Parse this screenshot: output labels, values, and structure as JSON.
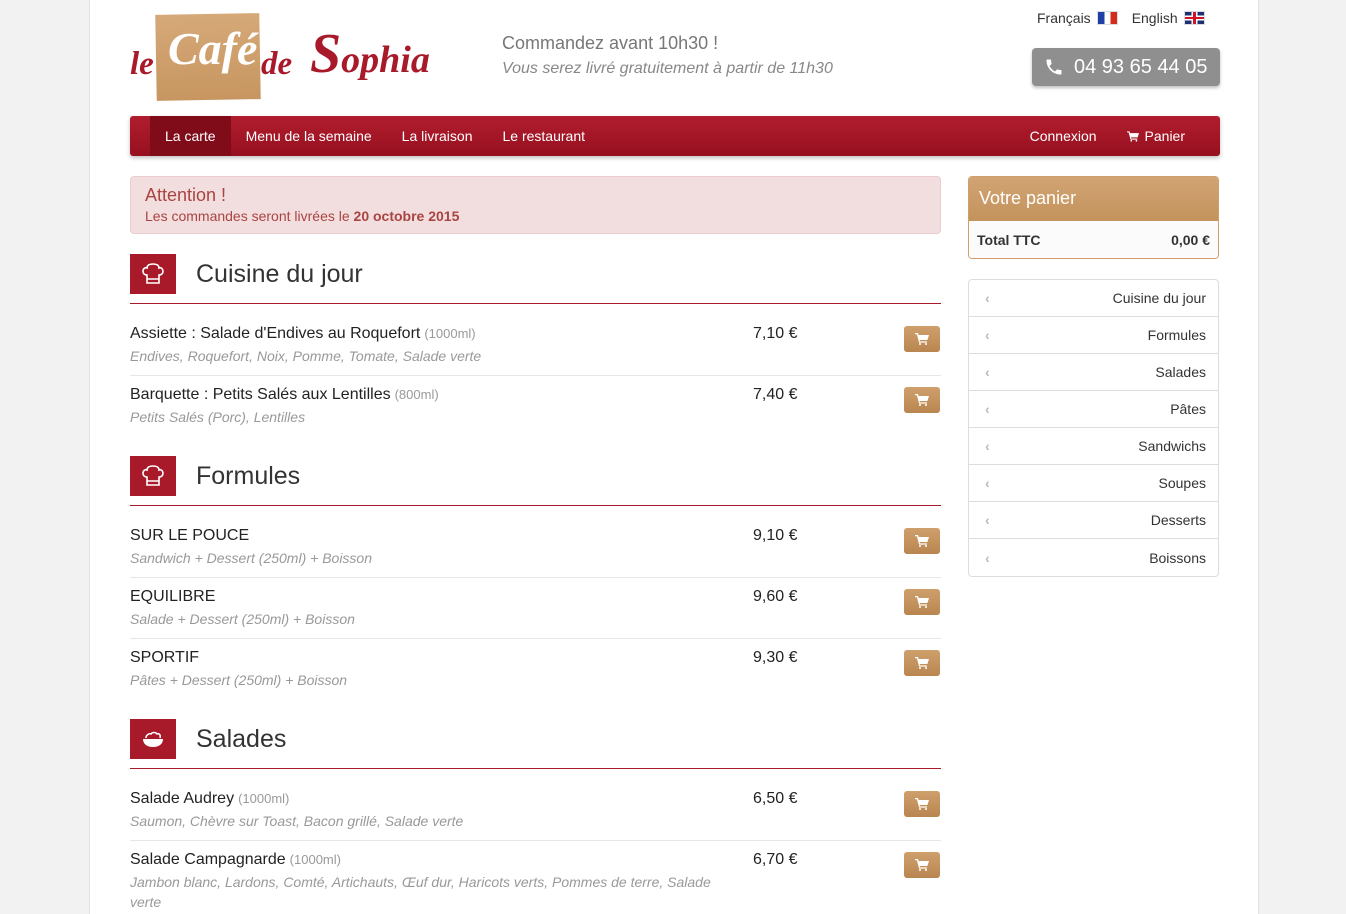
{
  "header": {
    "logo": {
      "le": "le",
      "cafe": "Café",
      "de": "de",
      "sophia_initial": "S",
      "sophia_rest": "ophia"
    },
    "tagline": "Commandez avant 10h30 !",
    "subtagline": "Vous serez livré gratuitement à partir de 11h30",
    "languages": [
      {
        "label": "Français",
        "flag": "flag-france-icon"
      },
      {
        "label": "English",
        "flag": "flag-uk-icon"
      }
    ],
    "phone": "04 93 65 44 05"
  },
  "nav": {
    "items": [
      "La carte",
      "Menu de la semaine",
      "La livraison",
      "Le restaurant"
    ],
    "active": "La carte",
    "login": "Connexion",
    "cart": "Panier"
  },
  "alert": {
    "title": "Attention !",
    "text": "Les commandes seront livrées le ",
    "date": "20 octobre 2015"
  },
  "sections": [
    {
      "title": "Cuisine du jour",
      "icon": "chef-hat-icon",
      "items": [
        {
          "name": "Assiette : Salade d'Endives au Roquefort",
          "size": "(1000ml)",
          "desc": "Endives, Roquefort, Noix, Pomme, Tomate, Salade verte",
          "price": "7,10 €"
        },
        {
          "name": "Barquette : Petits Salés aux Lentilles",
          "size": "(800ml)",
          "desc": "Petits Salés (Porc), Lentilles",
          "price": "7,40 €"
        }
      ]
    },
    {
      "title": "Formules",
      "icon": "chef-hat-icon",
      "items": [
        {
          "name": "SUR LE POUCE",
          "size": "",
          "desc": "Sandwich + Dessert (250ml) + Boisson",
          "price": "9,10 €"
        },
        {
          "name": "EQUILIBRE",
          "size": "",
          "desc": "Salade + Dessert (250ml) + Boisson",
          "price": "9,60 €"
        },
        {
          "name": "SPORTIF",
          "size": "",
          "desc": "Pâtes + Dessert (250ml) + Boisson",
          "price": "9,30 €"
        }
      ]
    },
    {
      "title": "Salades",
      "icon": "salad-bowl-icon",
      "items": [
        {
          "name": "Salade Audrey",
          "size": "(1000ml)",
          "desc": "Saumon, Chèvre sur Toast, Bacon grillé, Salade verte",
          "price": "6,50 €"
        },
        {
          "name": "Salade Campagnarde",
          "size": "(1000ml)",
          "desc": "Jambon blanc, Lardons, Comté, Artichauts, Œuf dur, Haricots verts, Pommes de terre, Salade verte",
          "price": "6,70 €"
        }
      ]
    }
  ],
  "sidebar": {
    "cart_title": "Votre panier",
    "total_label": "Total TTC",
    "total_value": "0,00 €",
    "categories": [
      "Cuisine du jour",
      "Formules",
      "Salades",
      "Pâtes",
      "Sandwichs",
      "Soupes",
      "Desserts",
      "Boissons"
    ]
  },
  "colors": {
    "brand_red": "#a8192a",
    "accent_tan": "#c79660",
    "alert_bg": "#f2dede"
  }
}
